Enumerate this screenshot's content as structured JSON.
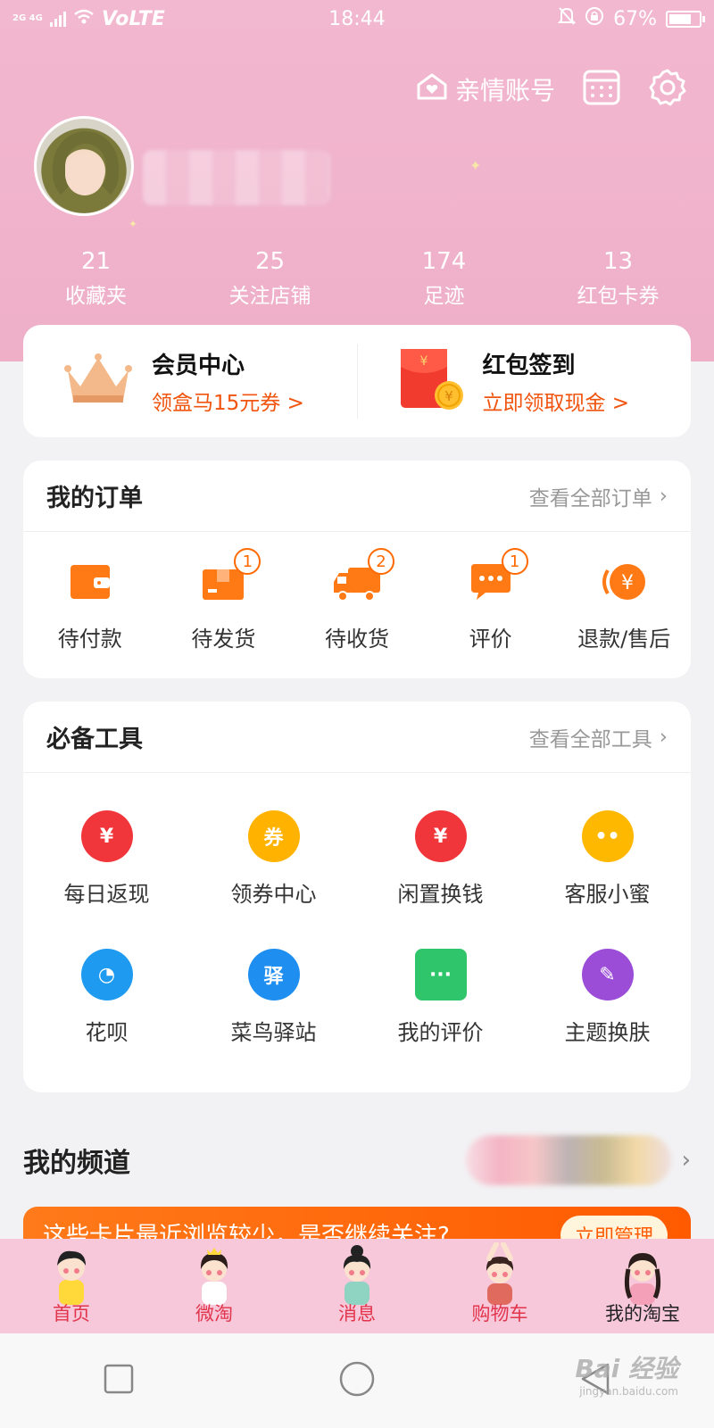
{
  "status": {
    "network": "2G 4G",
    "volte": "VoLTE",
    "time": "18:44",
    "battery": "67%"
  },
  "header": {
    "family_account": "亲情账号"
  },
  "stats": [
    {
      "num": "21",
      "label": "收藏夹"
    },
    {
      "num": "25",
      "label": "关注店铺"
    },
    {
      "num": "174",
      "label": "足迹"
    },
    {
      "num": "13",
      "label": "红包卡券"
    }
  ],
  "promo": {
    "member": {
      "title": "会员中心",
      "sub": "领盒马15元券 >"
    },
    "redpack": {
      "title": "红包签到",
      "sub": "立即领取现金 >"
    }
  },
  "orders": {
    "title": "我的订单",
    "more": "查看全部订单",
    "items": [
      {
        "label": "待付款",
        "icon": "wallet-icon",
        "badge": ""
      },
      {
        "label": "待发货",
        "icon": "box-icon",
        "badge": "1"
      },
      {
        "label": "待收货",
        "icon": "truck-icon",
        "badge": "2"
      },
      {
        "label": "评价",
        "icon": "comment-icon",
        "badge": "1"
      },
      {
        "label": "退款/售后",
        "icon": "refund-icon",
        "badge": ""
      }
    ]
  },
  "tools": {
    "title": "必备工具",
    "more": "查看全部工具",
    "items": [
      {
        "label": "每日返现",
        "glyph": "¥",
        "color": "#f0363a"
      },
      {
        "label": "领券中心",
        "glyph": "券",
        "color": "#ffb300"
      },
      {
        "label": "闲置换钱",
        "glyph": "¥",
        "color": "#f0363a"
      },
      {
        "label": "客服小蜜",
        "glyph": "••",
        "color": "#ffb800"
      },
      {
        "label": "花呗",
        "glyph": "◔",
        "color": "#1e9bf0"
      },
      {
        "label": "菜鸟驿站",
        "glyph": "驿",
        "color": "#1e8ff0"
      },
      {
        "label": "我的评价",
        "glyph": "···",
        "color": "#2fc56a"
      },
      {
        "label": "主题换肤",
        "glyph": "✎",
        "color": "#9b4dd8"
      }
    ]
  },
  "channel": {
    "title": "我的频道"
  },
  "banner": {
    "text": "这些卡片最近浏览较少，是否继续关注?",
    "button": "立即管理"
  },
  "tabbar": [
    {
      "label": "首页",
      "active": false
    },
    {
      "label": "微淘",
      "active": false
    },
    {
      "label": "消息",
      "active": false
    },
    {
      "label": "购物车",
      "active": false
    },
    {
      "label": "我的淘宝",
      "active": true
    }
  ],
  "watermark": {
    "brand": "Bai 经验",
    "url": "jingyan.baidu.com"
  },
  "colors": {
    "header_pink": "#f0b3cb",
    "accent_orange": "#ff6a00",
    "tab_pink": "#f7c7da"
  }
}
